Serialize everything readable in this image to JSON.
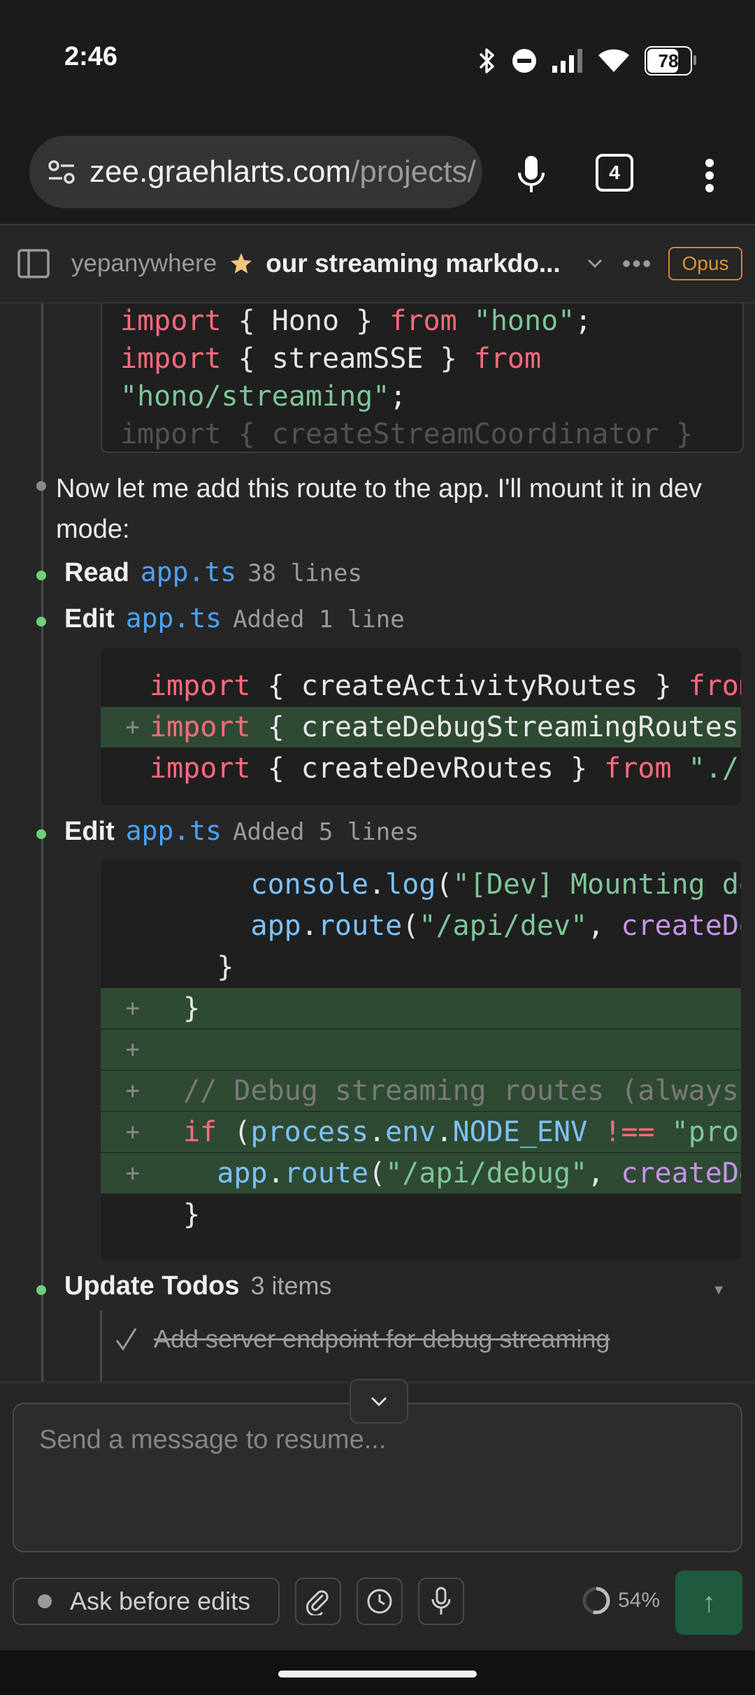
{
  "status_bar": {
    "time": "2:46",
    "battery": "78",
    "battery_level": 0.78
  },
  "browser": {
    "url_host": "zee.graehlarts.com",
    "url_path": "/projects/",
    "tab_count": "4"
  },
  "header": {
    "project": "yepanywhere",
    "session_title": "our streaming markdo...",
    "model_badge": "Opus"
  },
  "code_block_1": {
    "lines": [
      [
        {
          "t": "import",
          "c": "kw"
        },
        {
          "t": " { Hono } ",
          "c": "plain"
        },
        {
          "t": "from",
          "c": "kw"
        },
        {
          "t": " ",
          "c": "plain"
        },
        {
          "t": "\"hono\"",
          "c": "str"
        },
        {
          "t": ";",
          "c": "plain"
        }
      ],
      [
        {
          "t": "import",
          "c": "kw"
        },
        {
          "t": " { streamSSE } ",
          "c": "plain"
        },
        {
          "t": "from",
          "c": "kw"
        }
      ],
      [
        {
          "t": "\"hono/streaming\"",
          "c": "str"
        },
        {
          "t": ";",
          "c": "plain"
        }
      ],
      [
        {
          "t": "import { createStreamCoordinator }",
          "c": "plain"
        }
      ]
    ]
  },
  "assistant_message": "Now let me add this route to the app. I'll mount it in dev mode:",
  "tool_calls": [
    {
      "verb": "Read",
      "file": "app.ts",
      "meta": "38 lines"
    },
    {
      "verb": "Edit",
      "file": "app.ts",
      "meta": "Added 1 line"
    },
    {
      "verb": "Edit",
      "file": "app.ts",
      "meta": "Added 5 lines"
    },
    {
      "verb": "Update Todos",
      "file": "",
      "meta": "3 items"
    }
  ],
  "diff_1": [
    {
      "gutter": "",
      "add": false,
      "parts": [
        {
          "t": "import",
          "c": "kw"
        },
        {
          "t": " { createActivityRoutes } ",
          "c": "plain"
        },
        {
          "t": "from",
          "c": "kw"
        }
      ]
    },
    {
      "gutter": "+",
      "add": true,
      "parts": [
        {
          "t": "import",
          "c": "kw"
        },
        {
          "t": " { createDebugStreamingRoutes }",
          "c": "plain"
        }
      ]
    },
    {
      "gutter": "",
      "add": false,
      "parts": [
        {
          "t": "import",
          "c": "kw"
        },
        {
          "t": " { createDevRoutes } ",
          "c": "plain"
        },
        {
          "t": "from",
          "c": "kw"
        },
        {
          "t": " ",
          "c": "plain"
        },
        {
          "t": "\"./r",
          "c": "str"
        }
      ]
    }
  ],
  "diff_2": [
    {
      "gutter": "",
      "add": false,
      "parts": [
        {
          "t": "      console",
          "c": "fn"
        },
        {
          "t": ".",
          "c": "plain"
        },
        {
          "t": "log",
          "c": "fn"
        },
        {
          "t": "(",
          "c": "plain"
        },
        {
          "t": "\"[Dev] Mounting de",
          "c": "str"
        }
      ]
    },
    {
      "gutter": "",
      "add": false,
      "parts": [
        {
          "t": "      app",
          "c": "fn"
        },
        {
          "t": ".",
          "c": "plain"
        },
        {
          "t": "route",
          "c": "fn"
        },
        {
          "t": "(",
          "c": "plain"
        },
        {
          "t": "\"/api/dev\"",
          "c": "str"
        },
        {
          "t": ", ",
          "c": "plain"
        },
        {
          "t": "createDe",
          "c": "prop"
        }
      ]
    },
    {
      "gutter": "",
      "add": false,
      "parts": [
        {
          "t": "    }",
          "c": "plain"
        }
      ]
    },
    {
      "gutter": "+",
      "add": true,
      "parts": [
        {
          "t": "  }",
          "c": "plain"
        }
      ]
    },
    {
      "gutter": "+",
      "add": true,
      "parts": [
        {
          "t": "",
          "c": "plain"
        }
      ]
    },
    {
      "gutter": "+",
      "add": true,
      "parts": [
        {
          "t": "  // Debug streaming routes (always",
          "c": "cmt"
        }
      ]
    },
    {
      "gutter": "+",
      "add": true,
      "parts": [
        {
          "t": "  if",
          "c": "kw"
        },
        {
          "t": " (",
          "c": "plain"
        },
        {
          "t": "process",
          "c": "fn"
        },
        {
          "t": ".",
          "c": "plain"
        },
        {
          "t": "env",
          "c": "fn"
        },
        {
          "t": ".",
          "c": "plain"
        },
        {
          "t": "NODE_ENV",
          "c": "fn"
        },
        {
          "t": " ",
          "c": "plain"
        },
        {
          "t": "!==",
          "c": "kw"
        },
        {
          "t": " ",
          "c": "plain"
        },
        {
          "t": "\"proc",
          "c": "str"
        }
      ]
    },
    {
      "gutter": "+",
      "add": true,
      "parts": [
        {
          "t": "    app",
          "c": "fn"
        },
        {
          "t": ".",
          "c": "plain"
        },
        {
          "t": "route",
          "c": "fn"
        },
        {
          "t": "(",
          "c": "plain"
        },
        {
          "t": "\"/api/debug\"",
          "c": "str"
        },
        {
          "t": ", ",
          "c": "plain"
        },
        {
          "t": "createDe",
          "c": "prop"
        }
      ]
    },
    {
      "gutter": "",
      "add": false,
      "parts": [
        {
          "t": "  }",
          "c": "plain"
        }
      ]
    }
  ],
  "todos": [
    {
      "text": "Add server endpoint for debug streaming",
      "done": true
    }
  ],
  "composer": {
    "placeholder": "Send a message to resume...",
    "mode_label": "Ask before edits",
    "context_usage": "54%",
    "context_fraction": 0.54,
    "send_symbol": "↑"
  },
  "colors": {
    "accent_green": "#6fcf7a",
    "link_blue": "#4da3ff",
    "opus_orange": "#e0922a",
    "diff_add_bg": "#2f4a33"
  }
}
